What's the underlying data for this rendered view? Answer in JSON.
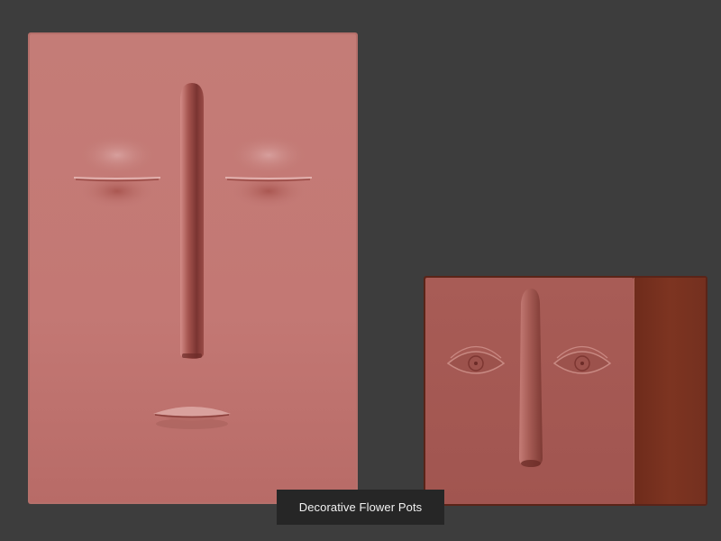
{
  "caption": {
    "text": "Decorative Flower Pots"
  },
  "colors": {
    "background": "#3d3d3d",
    "large_pot": "#c57d78",
    "small_pot_front": "#a65b55",
    "small_pot_side": "#7a321f",
    "caption_background": "#262626",
    "caption_text": "#f2f2f2"
  },
  "objects": [
    {
      "name": "large-face-planter",
      "features": [
        "closed-eyes",
        "long-nose",
        "lips"
      ]
    },
    {
      "name": "small-face-planter",
      "features": [
        "open-eyes",
        "long-nose"
      ]
    }
  ]
}
